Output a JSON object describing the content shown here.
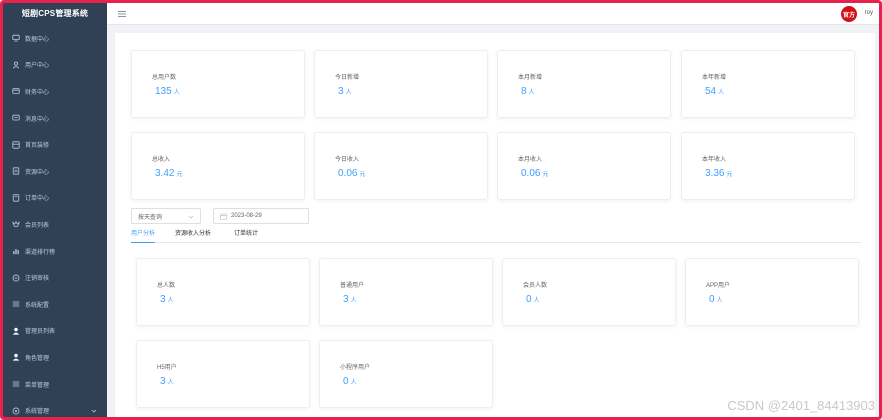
{
  "app": {
    "title": "短剧CPS管理系统"
  },
  "sidebar": {
    "items": [
      {
        "label": "数据中心",
        "icon": "monitor-icon"
      },
      {
        "label": "用户中心",
        "icon": "user-icon"
      },
      {
        "label": "财务中心",
        "icon": "wallet-icon"
      },
      {
        "label": "消息中心",
        "icon": "message-icon"
      },
      {
        "label": "首页装修",
        "icon": "home-icon"
      },
      {
        "label": "资源中心",
        "icon": "resource-icon"
      },
      {
        "label": "订单中心",
        "icon": "order-icon"
      },
      {
        "label": "会员列表",
        "icon": "vip-icon"
      },
      {
        "label": "渠道排行榜",
        "icon": "chart-icon"
      },
      {
        "label": "注销审核",
        "icon": "audit-icon"
      },
      {
        "label": "系统配置",
        "icon": "config-icon"
      },
      {
        "label": "管理员列表",
        "icon": "admin-icon"
      },
      {
        "label": "角色管理",
        "icon": "role-icon"
      },
      {
        "label": "菜单管理",
        "icon": "menu-icon"
      },
      {
        "label": "系统管理",
        "icon": "system-icon"
      }
    ]
  },
  "topbar": {
    "avatar_text": "官方",
    "username": "roy"
  },
  "stats_top": [
    {
      "label": "总用户数",
      "value": "135",
      "unit": "人"
    },
    {
      "label": "今日新增",
      "value": "3",
      "unit": "人"
    },
    {
      "label": "本月新增",
      "value": "8",
      "unit": "人"
    },
    {
      "label": "本年新增",
      "value": "54",
      "unit": "人"
    }
  ],
  "stats_income": [
    {
      "label": "总收入",
      "value": "3.42",
      "unit": "元"
    },
    {
      "label": "今日收入",
      "value": "0.06",
      "unit": "元"
    },
    {
      "label": "本月收入",
      "value": "0.06",
      "unit": "元"
    },
    {
      "label": "本年收入",
      "value": "3.36",
      "unit": "元"
    }
  ],
  "filter": {
    "mode": "按天查询",
    "date": "2023-08-29"
  },
  "tabs": [
    {
      "label": "用户分析",
      "active": true
    },
    {
      "label": "资源收入分析",
      "active": false
    },
    {
      "label": "订单统计",
      "active": false
    }
  ],
  "user_stats": [
    {
      "label": "总人数",
      "value": "3",
      "unit": "人"
    },
    {
      "label": "普通用户",
      "value": "3",
      "unit": "人"
    },
    {
      "label": "会员人数",
      "value": "0",
      "unit": "人"
    },
    {
      "label": "APP用户",
      "value": "0",
      "unit": "人"
    },
    {
      "label": "H5用户",
      "value": "3",
      "unit": "人"
    },
    {
      "label": "小程序用户",
      "value": "0",
      "unit": "人"
    }
  ],
  "watermark": "CSDN @2401_84413903",
  "colors": {
    "sidebar_bg": "#304156",
    "accent": "#409eff",
    "frame": "#e8224f"
  }
}
